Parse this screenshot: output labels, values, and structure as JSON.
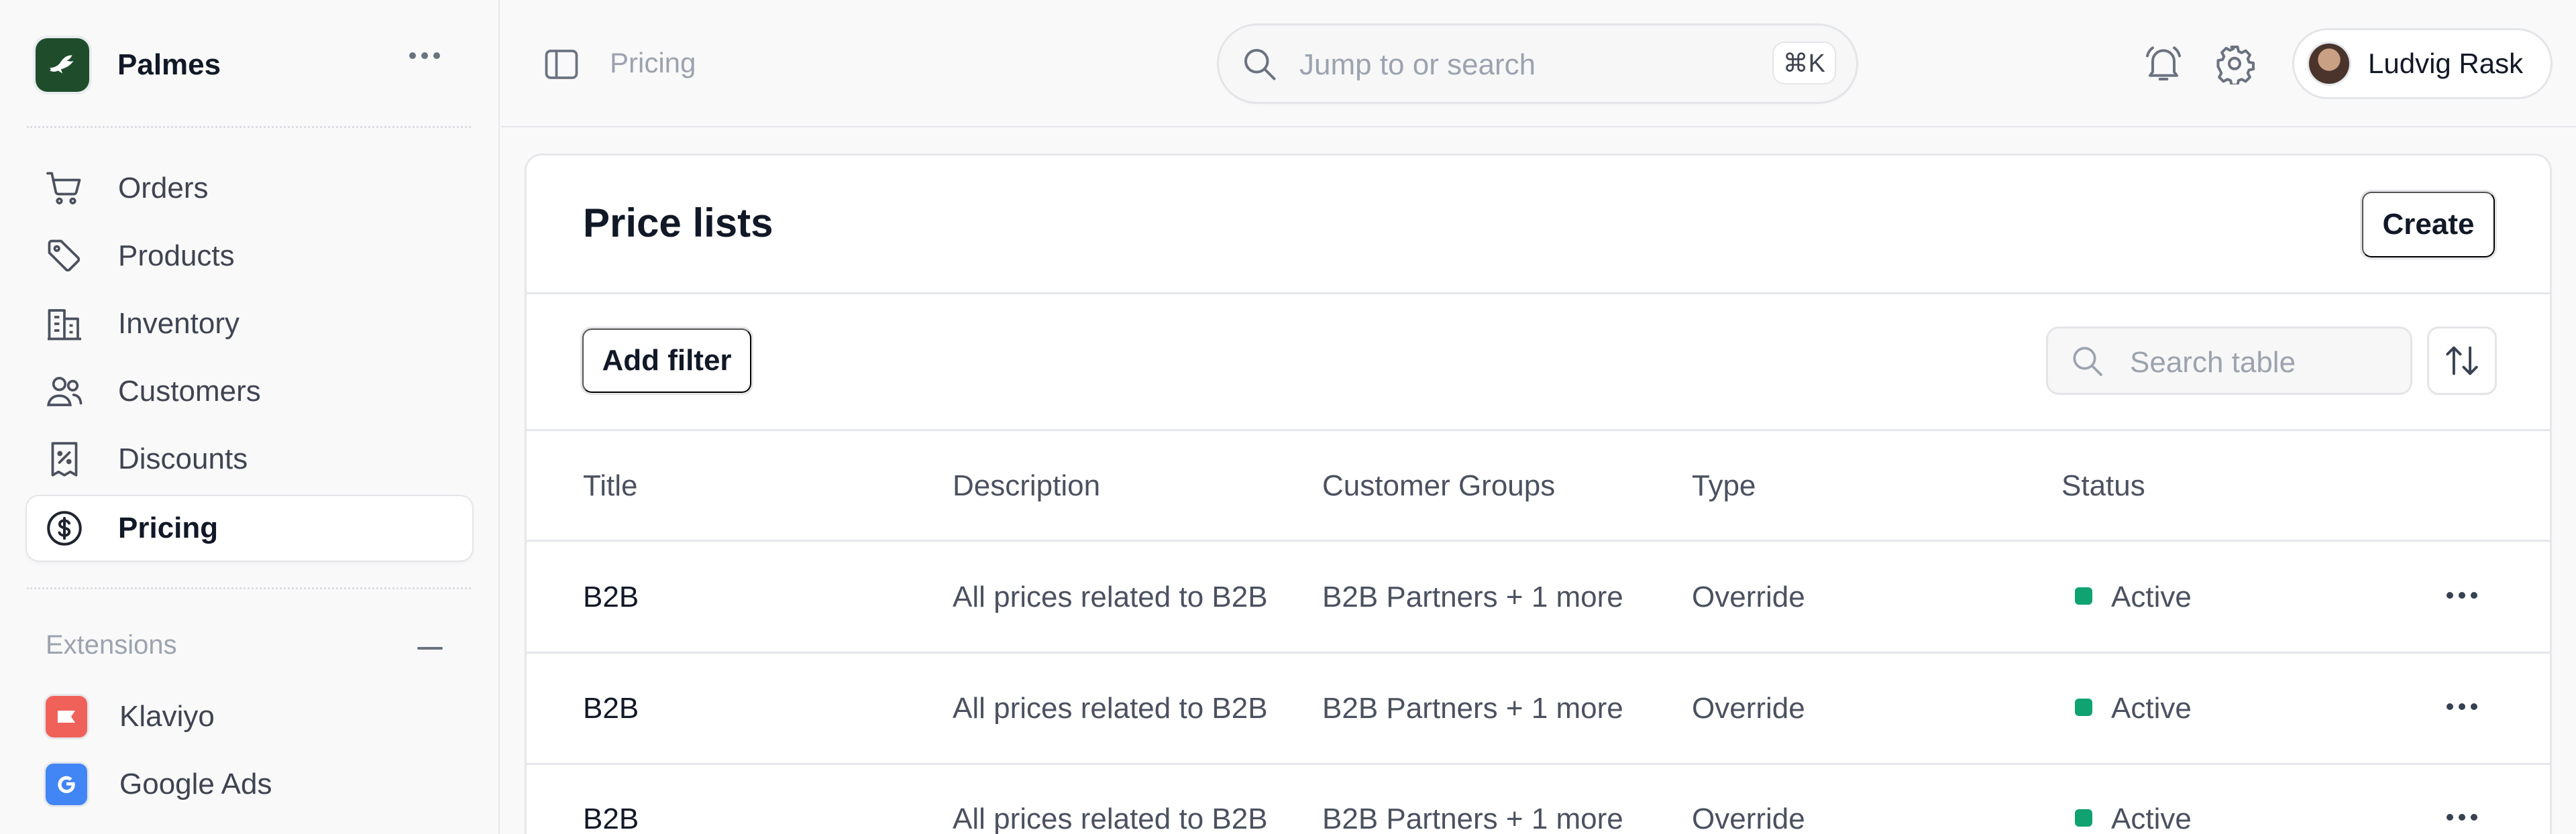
{
  "app": {
    "store_name": "Palmes"
  },
  "sidebar": {
    "items": [
      {
        "label": "Orders",
        "icon": "cart-icon"
      },
      {
        "label": "Products",
        "icon": "tag-icon"
      },
      {
        "label": "Inventory",
        "icon": "building-icon"
      },
      {
        "label": "Customers",
        "icon": "users-icon"
      },
      {
        "label": "Discounts",
        "icon": "receipt-percent-icon"
      },
      {
        "label": "Pricing",
        "icon": "currency-dollar-icon",
        "active": true
      }
    ],
    "extensions_label": "Extensions",
    "extensions": [
      {
        "label": "Klaviyo",
        "icon": "klaviyo-icon",
        "color": "#f0615a"
      },
      {
        "label": "Google Ads",
        "icon": "google-ads-icon",
        "color": "#4285f4"
      }
    ]
  },
  "topbar": {
    "breadcrumb": "Pricing",
    "search_placeholder": "Jump to or search",
    "shortcut": "⌘K",
    "user_name": "Ludvig Rask"
  },
  "main": {
    "title": "Price lists",
    "create_label": "Create",
    "add_filter_label": "Add filter",
    "search_placeholder": "Search table",
    "columns": [
      "Title",
      "Description",
      "Customer Groups",
      "Type",
      "Status"
    ],
    "rows": [
      {
        "title": "B2B",
        "description": "All prices related to B2B",
        "groups": "B2B Partners + 1 more",
        "type": "Override",
        "status": "Active"
      },
      {
        "title": "B2B",
        "description": "All prices related to B2B",
        "groups": "B2B Partners + 1 more",
        "type": "Override",
        "status": "Active"
      },
      {
        "title": "B2B",
        "description": "All prices related to B2B",
        "groups": "B2B Partners + 1 more",
        "type": "Override",
        "status": "Active"
      }
    ]
  },
  "colors": {
    "brand": "#1f4d2c",
    "status_active": "#10a271"
  }
}
